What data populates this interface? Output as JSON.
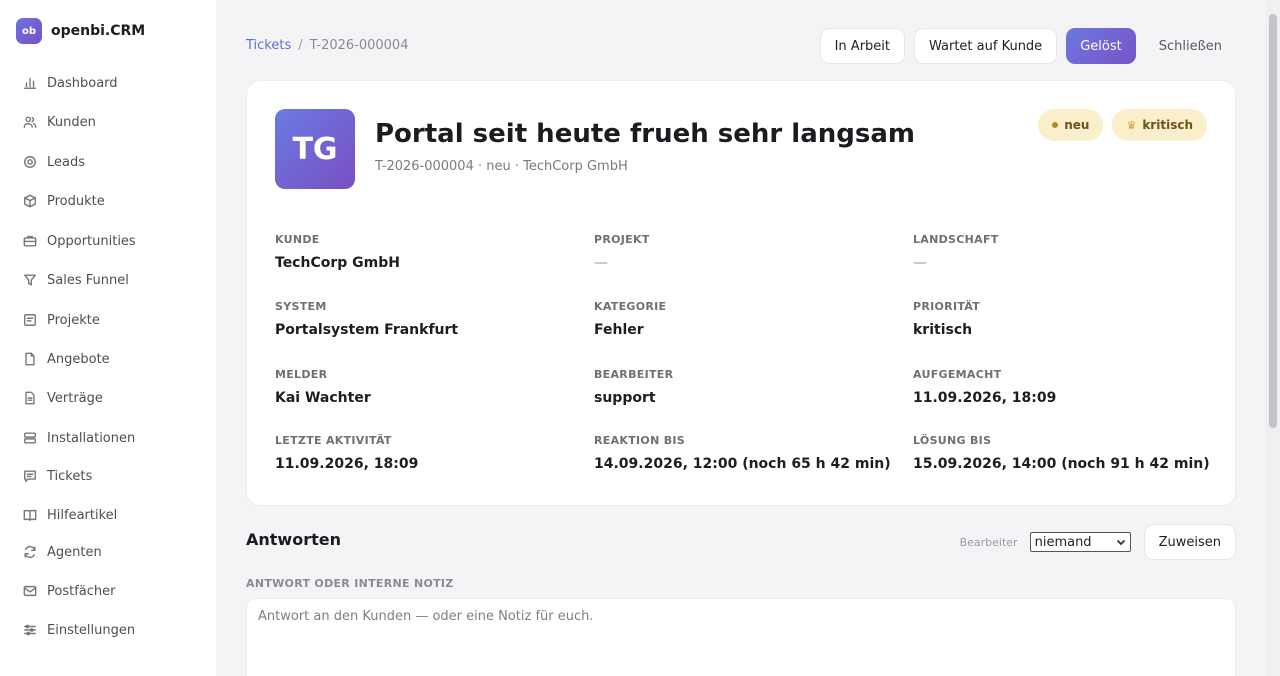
{
  "brand": {
    "logo_text": "ob",
    "name": "openbi.CRM"
  },
  "sidebar": {
    "items": [
      {
        "label": "Dashboard",
        "icon": "bar-chart-icon"
      },
      {
        "label": "Kunden",
        "icon": "users-icon"
      },
      {
        "label": "Leads",
        "icon": "target-icon"
      },
      {
        "label": "Produkte",
        "icon": "box-icon"
      },
      {
        "label": "Opportunities",
        "icon": "briefcase-icon"
      },
      {
        "label": "Sales Funnel",
        "icon": "funnel-icon"
      },
      {
        "label": "Projekte",
        "icon": "clipboard-icon"
      },
      {
        "label": "Angebote",
        "icon": "document-icon"
      },
      {
        "label": "Verträge",
        "icon": "contract-icon"
      },
      {
        "label": "Installationen",
        "icon": "server-icon"
      },
      {
        "label": "Tickets",
        "icon": "message-icon"
      },
      {
        "label": "Hilfeartikel",
        "icon": "book-icon"
      },
      {
        "label": "Agenten",
        "icon": "refresh-icon"
      },
      {
        "label": "Postfächer",
        "icon": "mail-icon"
      },
      {
        "label": "Einstellungen",
        "icon": "sliders-icon"
      }
    ]
  },
  "breadcrumb": {
    "parent": "Tickets",
    "separator": "/",
    "current": "T-2026-000004"
  },
  "actions": {
    "in_arbeit": "In Arbeit",
    "wartet": "Wartet auf Kunde",
    "geloest": "Gelöst",
    "schliessen": "Schließen"
  },
  "ticket": {
    "initials": "TG",
    "title": "Portal seit heute frueh sehr langsam",
    "subtitle": "T-2026-000004 · neu · TechCorp GmbH",
    "badges": {
      "status": "neu",
      "priority": "kritisch"
    }
  },
  "fields": {
    "kunde": {
      "label": "Kunde",
      "value": "TechCorp GmbH"
    },
    "projekt": {
      "label": "Projekt",
      "value": "—"
    },
    "landschaft": {
      "label": "Landschaft",
      "value": "—"
    },
    "system": {
      "label": "System",
      "value": "Portalsystem Frankfurt"
    },
    "kategorie": {
      "label": "Kategorie",
      "value": "Fehler"
    },
    "prioritaet": {
      "label": "Priorität",
      "value": "kritisch"
    },
    "melder": {
      "label": "Melder",
      "value": "Kai Wachter"
    },
    "bearbeiter": {
      "label": "Bearbeiter",
      "value": "support"
    },
    "aufgemacht": {
      "label": "Aufgemacht",
      "value": "11.09.2026, 18:09"
    },
    "letzte_aktivitaet": {
      "label": "Letzte Aktivität",
      "value": "11.09.2026, 18:09"
    },
    "reaktion_bis": {
      "label": "Reaktion bis",
      "value": "14.09.2026, 12:00 (noch 65 h 42 min)"
    },
    "loesung_bis": {
      "label": "Lösung bis",
      "value": "15.09.2026, 14:00 (noch 91 h 42 min)"
    }
  },
  "reply": {
    "heading": "Antworten",
    "assign_label": "Bearbeiter",
    "assign_value": "niemand",
    "assign_button": "Zuweisen",
    "note_label": "ANTWORT ODER INTERNE NOTIZ",
    "note_placeholder": "Antwort an den Kunden — oder eine Notiz für euch."
  }
}
